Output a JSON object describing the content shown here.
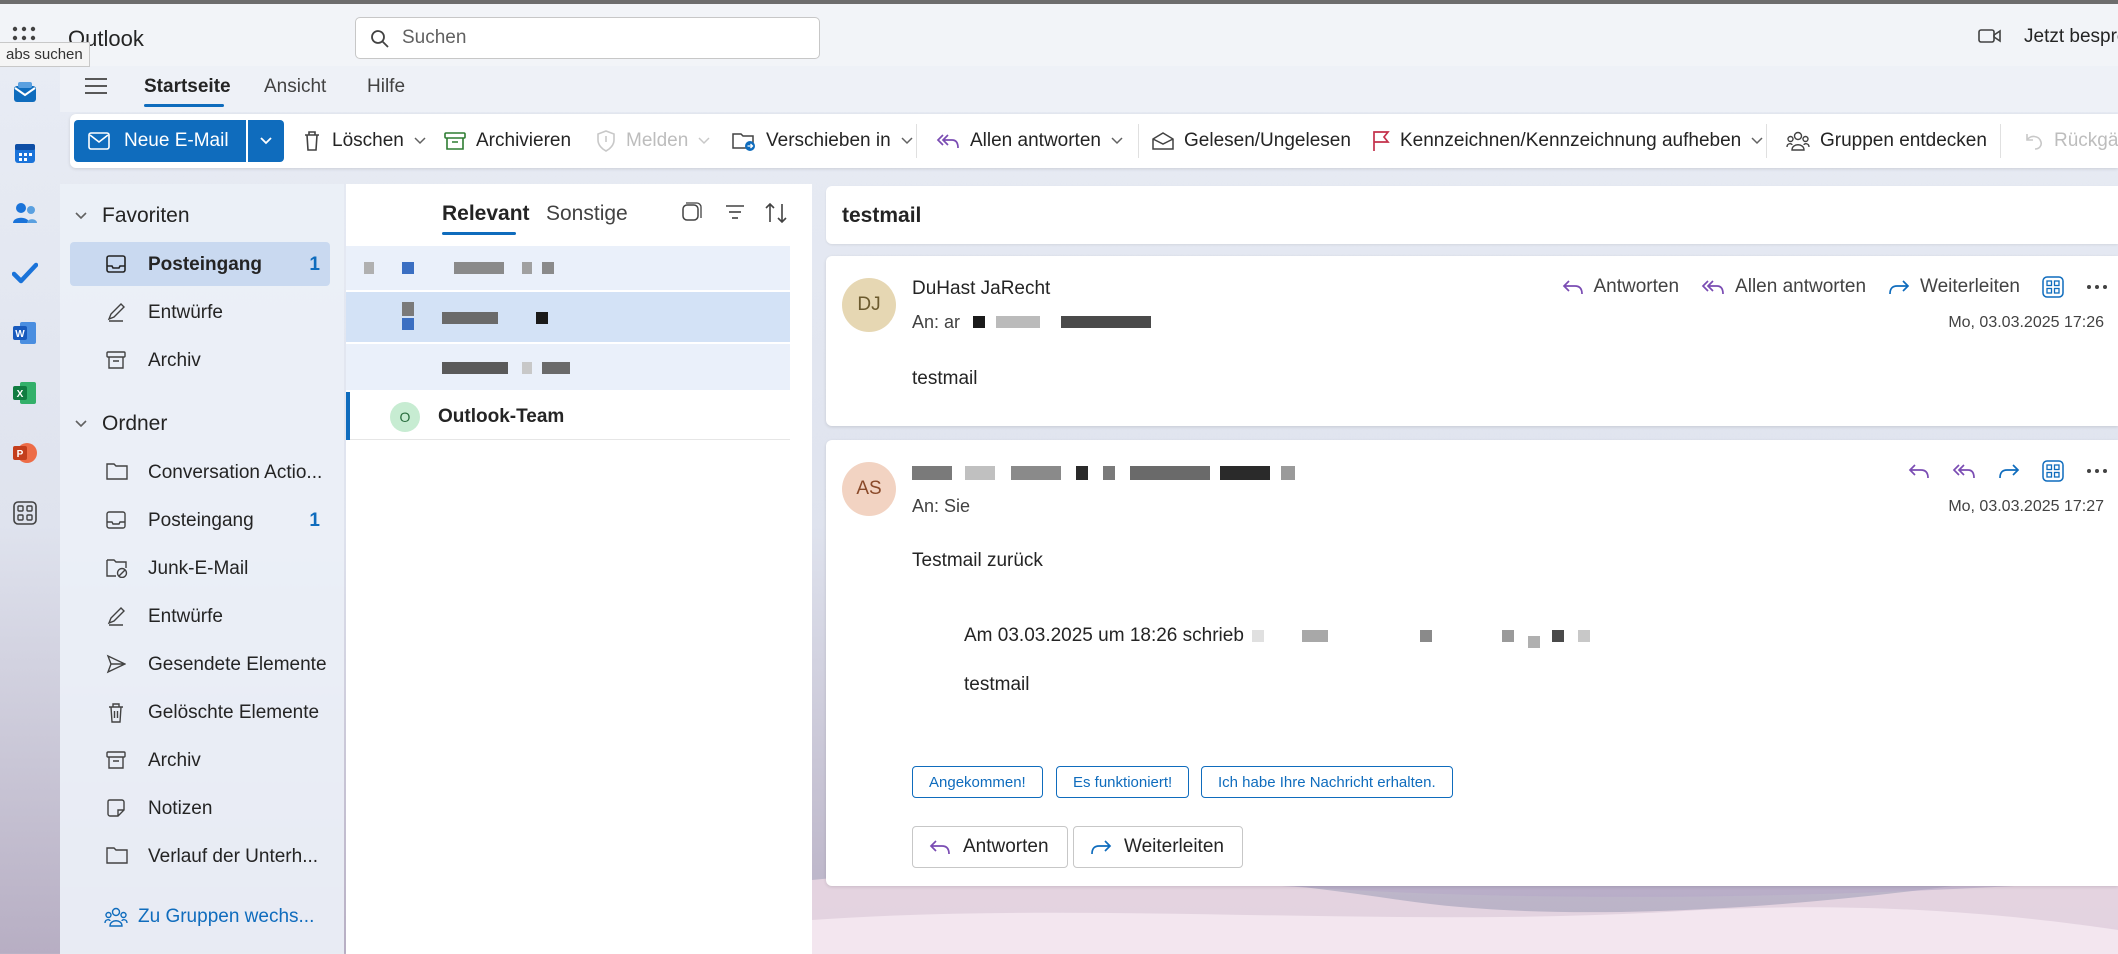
{
  "topbar": {
    "app_name": "Outlook",
    "tooltip": "abs suchen",
    "search_placeholder": "Suchen",
    "meet_label": "Jetzt bespre"
  },
  "tabs": [
    {
      "label": "Startseite",
      "active": true
    },
    {
      "label": "Ansicht",
      "active": false
    },
    {
      "label": "Hilfe",
      "active": false
    }
  ],
  "ribbon": {
    "new_mail": "Neue E-Mail",
    "delete": "Löschen",
    "archive": "Archivieren",
    "report": "Melden",
    "move": "Verschieben in",
    "reply_all": "Allen antworten",
    "read_unread": "Gelesen/Ungelesen",
    "flag": "Kennzeichnen/Kennzeichnung aufheben",
    "discover_groups": "Gruppen entdecken",
    "undo": "Rückgä"
  },
  "folders": {
    "favorites_label": "Favoriten",
    "favorites": [
      {
        "label": "Posteingang",
        "count": "1",
        "icon": "inbox-icon",
        "selected": true
      },
      {
        "label": "Entwürfe",
        "count": "",
        "icon": "drafts-icon",
        "selected": false
      },
      {
        "label": "Archiv",
        "count": "",
        "icon": "archive-icon",
        "selected": false
      }
    ],
    "folders_label": "Ordner",
    "items": [
      {
        "label": "Conversation Actio...",
        "count": "",
        "icon": "folder-icon"
      },
      {
        "label": "Posteingang",
        "count": "1",
        "icon": "inbox-icon"
      },
      {
        "label": "Junk-E-Mail",
        "count": "",
        "icon": "junk-icon"
      },
      {
        "label": "Entwürfe",
        "count": "",
        "icon": "drafts-icon"
      },
      {
        "label": "Gesendete Elemente",
        "count": "",
        "icon": "sent-icon"
      },
      {
        "label": "Gelöschte Elemente",
        "count": "",
        "icon": "trash-icon"
      },
      {
        "label": "Archiv",
        "count": "",
        "icon": "archive-icon"
      },
      {
        "label": "Notizen",
        "count": "",
        "icon": "notes-icon"
      },
      {
        "label": "Verlauf der Unterh...",
        "count": "",
        "icon": "folder-icon"
      }
    ],
    "groups_link": "Zu Gruppen wechs..."
  },
  "message_list": {
    "tab_relevant": "Relevant",
    "tab_other": "Sonstige",
    "team_sender": "Outlook-Team",
    "team_avatar": "O"
  },
  "reading": {
    "subject": "testmail",
    "msg1": {
      "avatar": "DJ",
      "avatar_color": "#e6d7b3",
      "sender": "DuHast JaRecht",
      "to_label": "An:",
      "to_prefix": "ar",
      "date": "Mo, 03.03.2025 17:26",
      "body": "testmail",
      "reply": "Antworten",
      "reply_all": "Allen antworten",
      "forward": "Weiterleiten"
    },
    "msg2": {
      "avatar": "AS",
      "avatar_color": "#f2d3c2",
      "to_label": "An:",
      "to_value": "Sie",
      "date": "Mo, 03.03.2025 17:27",
      "body": "Testmail zurück",
      "quote_header": "Am 03.03.2025 um 18:26 schrieb",
      "quote_body": "testmail",
      "quick_replies": [
        "Angekommen!",
        "Es funktioniert!",
        "Ich habe Ihre Nachricht erhalten."
      ],
      "reply": "Antworten",
      "forward": "Weiterleiten"
    }
  },
  "colors": {
    "accent": "#0f6cbd",
    "reply_icon": "#7a4cb3"
  }
}
